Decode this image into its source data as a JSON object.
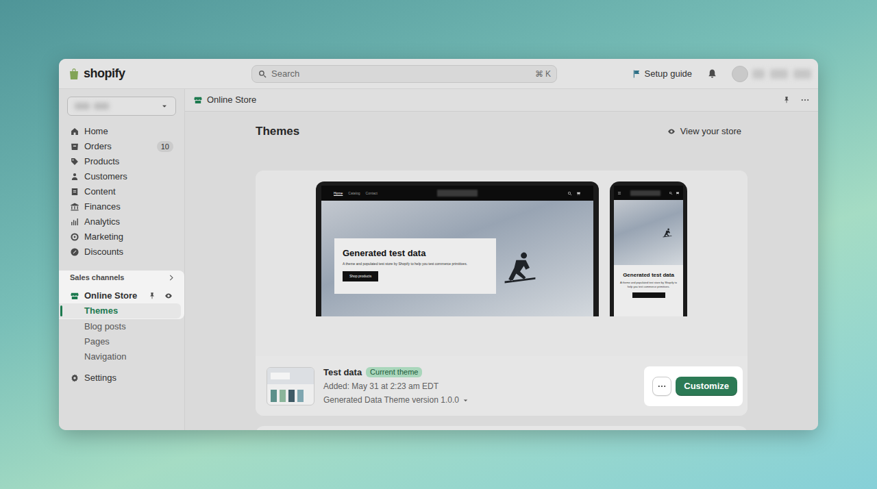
{
  "logo": {
    "text": "shopify"
  },
  "search": {
    "placeholder": "Search",
    "shortcut": "⌘ K"
  },
  "topbar": {
    "setup_guide": "Setup guide"
  },
  "sidebar": {
    "items": [
      {
        "label": "Home"
      },
      {
        "label": "Orders",
        "badge": "10"
      },
      {
        "label": "Products"
      },
      {
        "label": "Customers"
      },
      {
        "label": "Content"
      },
      {
        "label": "Finances"
      },
      {
        "label": "Analytics"
      },
      {
        "label": "Marketing"
      },
      {
        "label": "Discounts"
      }
    ],
    "sales_channels": {
      "title": "Sales channels",
      "highlighted": true
    },
    "online_store": {
      "label": "Online Store"
    },
    "subitems": [
      {
        "label": "Themes",
        "selected": true
      },
      {
        "label": "Blog posts",
        "selected": false
      },
      {
        "label": "Pages",
        "selected": false
      },
      {
        "label": "Navigation",
        "selected": false
      }
    ],
    "settings": {
      "label": "Settings"
    }
  },
  "header": {
    "title": "Online Store"
  },
  "page": {
    "title": "Themes",
    "view_store": "View your store"
  },
  "preview": {
    "nav": [
      {
        "label": "Home",
        "selected": true
      },
      {
        "label": "Catalog",
        "selected": false
      },
      {
        "label": "Contact",
        "selected": false
      }
    ],
    "hero_title": "Generated test data",
    "hero_text": "A theme and populated test store by Shopify to help you test commerce primitives.",
    "button": "Shop products",
    "mobile_title": "Generated test data",
    "mobile_text": "A theme and populated test store by Shopify to help you test commerce primitives."
  },
  "theme": {
    "name": "Test data",
    "badge": "Current theme",
    "added": "Added: May 31 at 2:23 am EDT",
    "version": "Generated Data Theme version 1.0.0",
    "customize": "Customize",
    "actions_highlighted": true
  }
}
